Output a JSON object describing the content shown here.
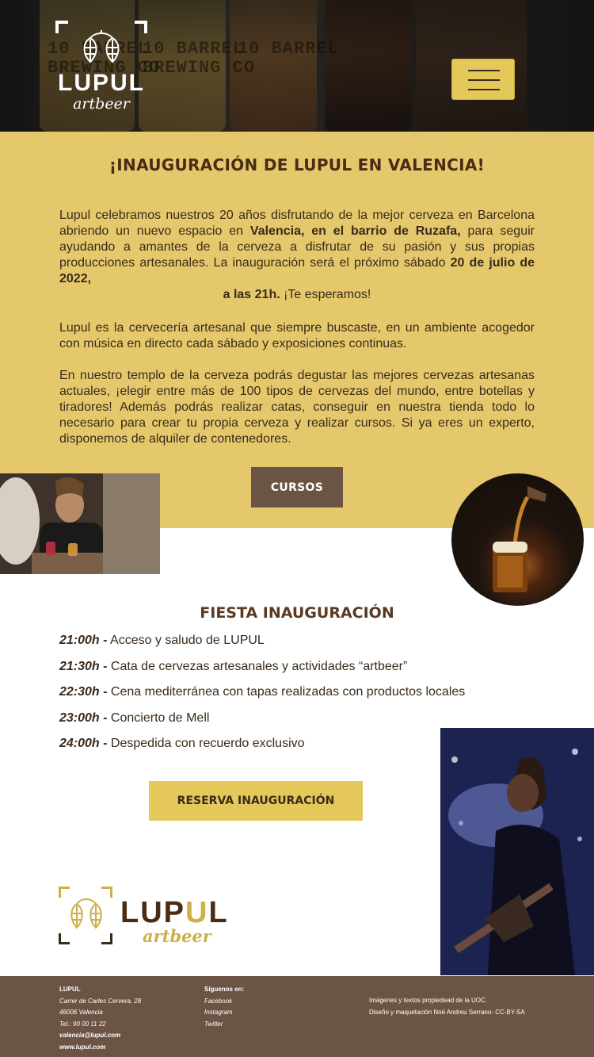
{
  "header": {
    "logo_word": "LUPUL",
    "logo_sub": "artbeer",
    "glass_texts": [
      "10 BARREL\nBREWING CO",
      "10 BARREL\nBREWING CO",
      "10 BARREL"
    ],
    "menu_icon": "hamburger-menu-icon"
  },
  "intro": {
    "title": "¡INAUGURACIÓN DE LUPUL EN VALENCIA!",
    "p1_a": "Lupul celebramos nuestros 20 años disfrutando de la mejor cerveza en Barcelona abriendo un nuevo espacio en ",
    "p1_b": "Valencia, en el barrio de Ruzafa,",
    "p1_c": " para seguir ayudando a amantes de la cerveza a disfrutar de su pasión y sus propias producciones artesanales. La inauguración será el próximo sábado ",
    "p1_d": "20 de julio de 2022,",
    "p1_e": "a las 21h.",
    "p1_f": " ¡Te esperamos!",
    "p2": "Lupul es la cervecería artesanal que siempre buscaste, en un ambiente acogedor con música en directo cada sábado y exposiciones continuas.",
    "p3": "En nuestro templo de la cerveza podrás degustar las mejores cervezas artesanas actuales, ¡elegir entre más de 100 tipos de cervezas del mundo, entre botellas y tiradores! Además podrás realizar catas, conseguir en nuestra tienda todo lo necesario para crear tu propia cerveza y realizar cursos. Si ya eres un experto, disponemos de alquiler de contenedores.",
    "cursos_label": "CURSOS"
  },
  "fiesta": {
    "title": "FIESTA INAUGURACIÓN",
    "items": [
      {
        "time": "21:00h",
        "text": " Acceso y saludo de LUPUL"
      },
      {
        "time": "21:30h",
        "text": " Cata de cervezas artesanales y actividades “artbeer”"
      },
      {
        "time": "22:30h",
        "text": " Cena mediterránea con tapas realizadas con productos locales"
      },
      {
        "time": "23:00h",
        "text": " Concierto de Mell"
      },
      {
        "time": "24:00h",
        "text": " Despedida con recuerdo exclusivo"
      }
    ],
    "reserva_label": "RESERVA INAUGURACIÓN"
  },
  "bottom_logo": {
    "word_a": "LUP",
    "word_b": "U",
    "word_c": "L",
    "sub": "artbeer"
  },
  "footer": {
    "col1": {
      "heading": "LUPUL",
      "address1": "Carrer de Carles Cervera, 28",
      "address2": "46006 Valencia",
      "phone": "Tel.: 90 00 11 22",
      "email": "valencia@lupul.com",
      "web": "www.lupul.com"
    },
    "col2": {
      "heading": "Síguenos en:",
      "links": [
        "Facebook",
        "Instagram",
        "Twitter"
      ]
    },
    "col3": {
      "line1": "Imágenes y textos propiedead de la UOC.",
      "line2": "Diseño y maquetación Noé Andreu Serrano- CC-BY-SA"
    }
  },
  "colors": {
    "accent_yellow": "#e5c86c",
    "button_yellow": "#e5c85a",
    "brown": "#6b5444",
    "dark_brown": "#4a2c14"
  }
}
